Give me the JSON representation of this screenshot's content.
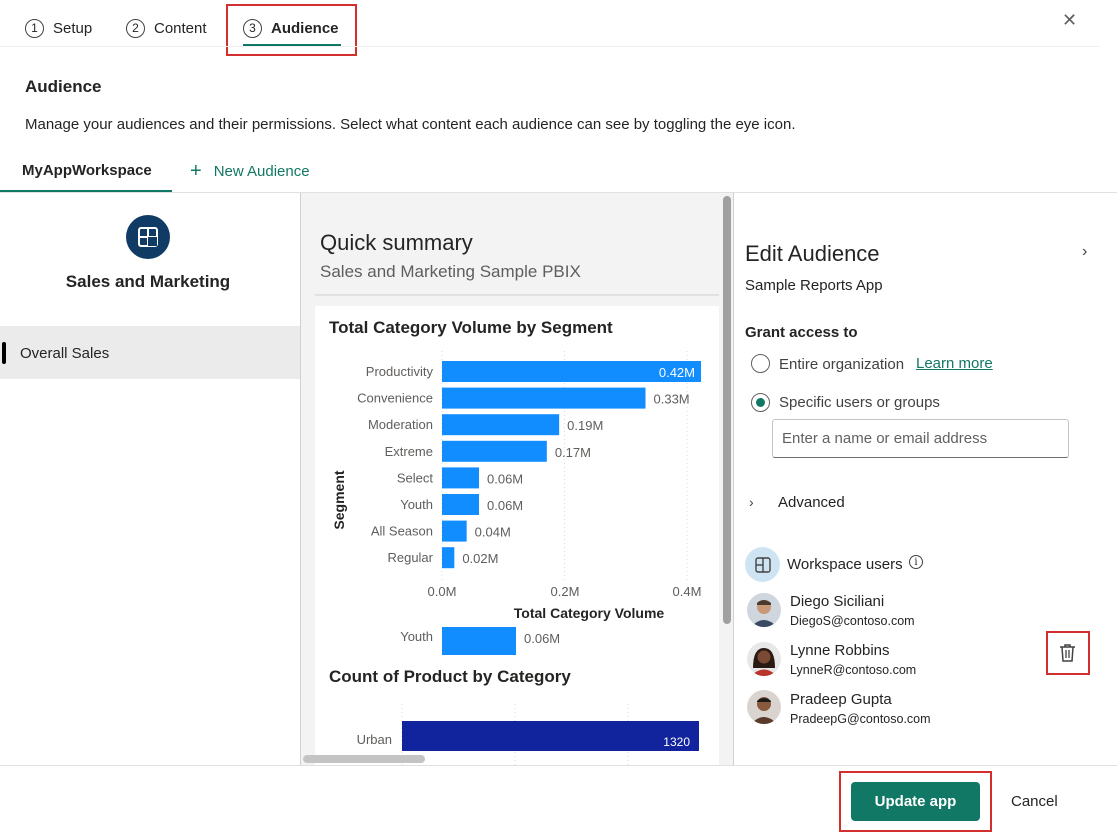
{
  "stepper": {
    "steps": [
      {
        "num": "1",
        "label": "Setup"
      },
      {
        "num": "2",
        "label": "Content"
      },
      {
        "num": "3",
        "label": "Audience"
      }
    ],
    "active": "Audience"
  },
  "close_icon": "close-icon",
  "page": {
    "heading": "Audience",
    "description": "Manage your audiences and their permissions. Select what content each audience can see by toggling the eye icon."
  },
  "tabs": {
    "workspace": "MyAppWorkspace",
    "new_audience": "New Audience"
  },
  "left_nav": {
    "app_name": "Sales and Marketing",
    "items": [
      {
        "label": "Overall Sales",
        "selected": true
      }
    ]
  },
  "preview": {
    "title": "Quick summary",
    "subtitle": "Sales and Marketing Sample PBIX",
    "chart1": {
      "title": "Total Category Volume by Segment",
      "xlabel": "Total Category Volume",
      "ylabel": "Segment",
      "ticks": [
        "0.0M",
        "0.2M",
        "0.4M"
      ],
      "overflow_label": "Youth",
      "overflow_value": "0.06M"
    },
    "chart2": {
      "title": "Count of Product by Category",
      "category": "Urban",
      "value_label": "1320"
    }
  },
  "chart_data": [
    {
      "type": "bar",
      "title": "Total Category Volume by Segment",
      "xlabel": "Total Category Volume",
      "ylabel": "Segment",
      "orientation": "horizontal",
      "categories": [
        "Productivity",
        "Convenience",
        "Moderation",
        "Extreme",
        "Select",
        "Youth",
        "All Season",
        "Regular"
      ],
      "values": [
        0.42,
        0.33,
        0.19,
        0.17,
        0.06,
        0.06,
        0.04,
        0.02
      ],
      "labels": [
        "0.42M",
        "0.33M",
        "0.19M",
        "0.17M",
        "0.06M",
        "0.06M",
        "0.04M",
        "0.02M"
      ],
      "xlim": [
        0,
        0.42
      ],
      "color": "#118dff"
    },
    {
      "type": "bar",
      "title": "Count of Product by Category",
      "orientation": "horizontal",
      "categories": [
        "Urban"
      ],
      "values": [
        1320
      ],
      "color": "#12239e"
    }
  ],
  "edit_audience": {
    "title": "Edit Audience",
    "app": "Sample Reports App",
    "grant_label": "Grant access to",
    "option_org": "Entire organization",
    "learn_more": "Learn more",
    "option_specific": "Specific users or groups",
    "selected_option": "Specific users or groups",
    "search_placeholder": "Enter a name or email address",
    "advanced": "Advanced",
    "workspace_users_label": "Workspace users",
    "users": [
      {
        "name": "Diego Siciliani",
        "email": "DiegoS@contoso.com"
      },
      {
        "name": "Lynne Robbins",
        "email": "LynneR@contoso.com"
      },
      {
        "name": "Pradeep Gupta",
        "email": "PradeepG@contoso.com"
      }
    ]
  },
  "footer": {
    "update": "Update app",
    "cancel": "Cancel"
  },
  "colors": {
    "accent": "#117865",
    "highlight": "#d32f2f",
    "bar_blue": "#118dff",
    "bar_navy": "#12239e"
  }
}
